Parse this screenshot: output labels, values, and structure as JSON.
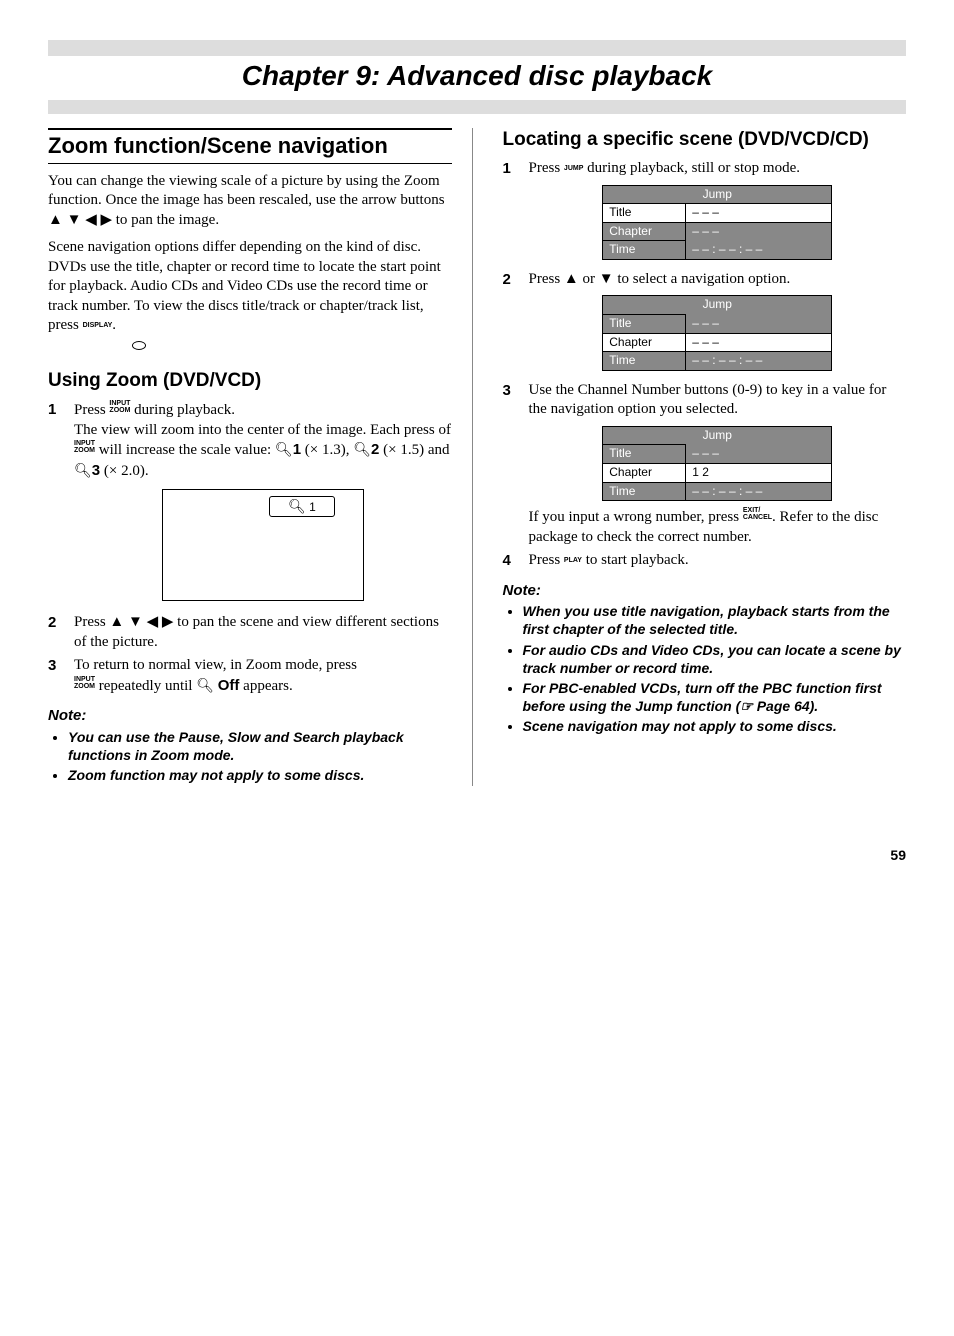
{
  "chapter_title": "Chapter 9: Advanced disc playback",
  "left": {
    "section_title": "Zoom function/Scene navigation",
    "intro1": "You can change the viewing scale of a picture by using the Zoom function. Once the image has been rescaled, use the arrow buttons ▲ ▼ ◀ ▶ to pan the image.",
    "intro2_a": "Scene navigation options differ depending on the kind of disc. DVDs use the title, chapter or record time to locate the start point for playback. Audio CDs and Video CDs use the record time or track number. To view the discs title/track or chapter/track list, press ",
    "intro2_b": ".",
    "sub1": "Using Zoom (DVD/VCD)",
    "step1a": "Press ",
    "step1b": " during playback.",
    "step1c": "The view will zoom into the center of the image. Each press of ",
    "step1d": " will increase the scale value: ",
    "scale_parts": [
      "1",
      " (× 1.3), ",
      "2",
      " (× 1.5) and ",
      "3",
      " (× 2.0)."
    ],
    "zoom_box_label": "1",
    "step2": "Press ▲ ▼ ◀ ▶ to pan the scene and view different sections of the picture.",
    "step3a": "To return to normal view, in Zoom mode, press ",
    "step3b": " repeatedly until ",
    "step3c": "Off",
    "step3d": " appears.",
    "note_h": "Note:",
    "notes": [
      "You can use the Pause, Slow and Search playback functions in Zoom mode.",
      "Zoom function may not apply to some discs."
    ],
    "zoom_label": "INPUT\nZOOM",
    "display_label": "DISPLAY"
  },
  "right": {
    "sub2": "Locating a specific scene (DVD/VCD/CD)",
    "step1": "during playback, still or stop mode.",
    "jump_label": "JUMP",
    "tbl_head": "Jump",
    "tbl_rows": [
      "Title",
      "Chapter",
      "Time"
    ],
    "dashes3": "– – –",
    "dashes_time": "– –   :   – –   :   – –",
    "step2": "Press ▲ or ▼ to select a navigation option.",
    "step3": "Use the Channel Number buttons (0-9) to key in a value for the navigation option you selected.",
    "chapter_val": "1 2",
    "wrong_a": "If you input a wrong number, press ",
    "wrong_b": ". Refer to the disc package to check the correct number.",
    "exit_label": "EXIT/\nCANCEL",
    "step4a": "Press ",
    "step4b": " to start playback.",
    "play_label": "PLAY",
    "note_h": "Note:",
    "notes": [
      "When you use title navigation, playback starts from the first chapter of the selected title.",
      "For audio CDs and Video CDs, you can locate a scene by track number or record time.",
      "For PBC-enabled VCDs, turn off the PBC function first before using the Jump function (☞ Page 64).",
      "Scene navigation may not apply to some discs."
    ]
  },
  "page_num": "59"
}
